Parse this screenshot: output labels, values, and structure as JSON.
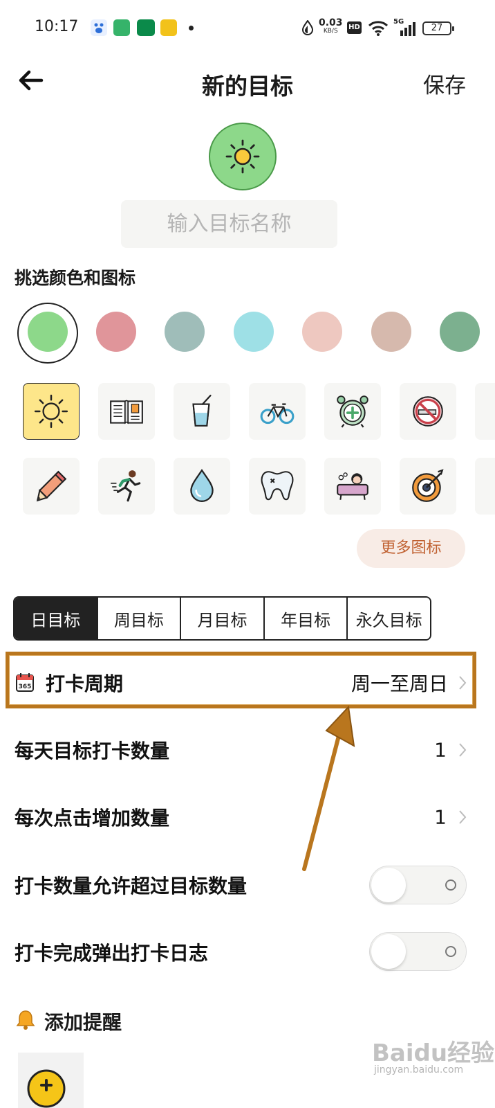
{
  "status_bar": {
    "time": "10:17",
    "net_speed_value": "0.03",
    "net_speed_unit": "KB/S",
    "hd_label": "HD",
    "signal_label": "5G",
    "battery_level": "27"
  },
  "header": {
    "title": "新的目标",
    "save_label": "保存",
    "back_icon": "arrow-left-icon"
  },
  "goal": {
    "selected_icon": "sun-icon",
    "selected_color": "#8dd88a",
    "name_value": "",
    "name_placeholder": "输入目标名称"
  },
  "picker": {
    "section_title": "挑选颜色和图标",
    "colors": [
      "#8dd88a",
      "#e0959a",
      "#9fbdb9",
      "#9ee0e6",
      "#eec8c0",
      "#d6b9ad",
      "#7cb08f"
    ],
    "selected_color_index": 0,
    "icons_row1": [
      "sun-icon",
      "open-book-icon",
      "drink-cup-icon",
      "bicycle-icon",
      "alarm-clock-icon",
      "no-smoking-icon"
    ],
    "icons_row2": [
      "pencil-icon",
      "runner-icon",
      "water-drop-icon",
      "tooth-icon",
      "bathtub-icon",
      "target-icon"
    ],
    "selected_icon_index": 0,
    "more_icons_label": "更多图标"
  },
  "goal_type_tabs": {
    "items": [
      "日目标",
      "周目标",
      "月目标",
      "年目标",
      "永久目标"
    ],
    "active_index": 0
  },
  "settings": {
    "checkin_period": {
      "label": "打卡周期",
      "value": "周一至周日",
      "icon": "calendar-365-icon"
    },
    "daily_target": {
      "label": "每天目标打卡数量",
      "value": "1"
    },
    "increment": {
      "label": "每次点击增加数量",
      "value": "1"
    },
    "allow_exceed": {
      "label": "打卡数量允许超过目标数量",
      "enabled": false
    },
    "popup_log": {
      "label": "打卡完成弹出打卡日志",
      "enabled": false
    }
  },
  "reminder": {
    "title": "添加提醒",
    "icon": "bell-icon"
  },
  "watermark": {
    "text": "Baidu经验",
    "sub": "jingyan.baidu.com"
  },
  "annotation_color": "#b9761e"
}
